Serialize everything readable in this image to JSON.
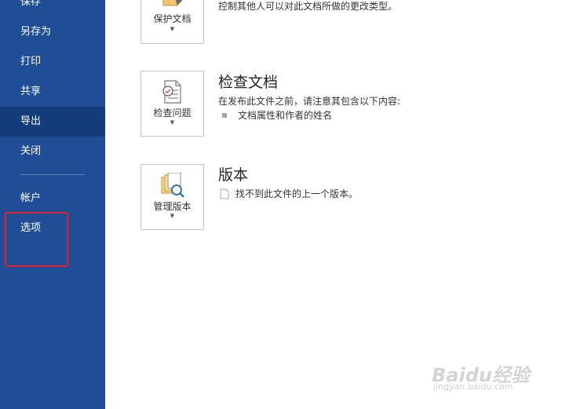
{
  "sidebar": {
    "items": [
      {
        "label": "保存"
      },
      {
        "label": "另存为"
      },
      {
        "label": "打印"
      },
      {
        "label": "共享"
      },
      {
        "label": "导出"
      },
      {
        "label": "关闭"
      },
      {
        "label": "帐户"
      },
      {
        "label": "选项"
      }
    ],
    "selected": "导出",
    "background_color": "#1f4e96",
    "selected_color": "#143c7a",
    "highlight_box_color": "#e0232a"
  },
  "protect": {
    "button_label": "保护文档",
    "description": "控制其他人可以对此文档所做的更改类型。",
    "icon": "lock-document-icon"
  },
  "inspect": {
    "button_label": "检查问题",
    "title": "检查文档",
    "description": "在发布此文件之前，请注意其包含以下内容:",
    "bullets": [
      "文档属性和作者的姓名"
    ],
    "icon": "inspect-document-icon"
  },
  "versions": {
    "button_label": "管理版本",
    "title": "版本",
    "description": "找不到此文件的上一个版本。",
    "icon": "manage-versions-icon"
  },
  "watermark": {
    "brand": "Baidu经验",
    "url": "jingyan.baidu.com"
  }
}
